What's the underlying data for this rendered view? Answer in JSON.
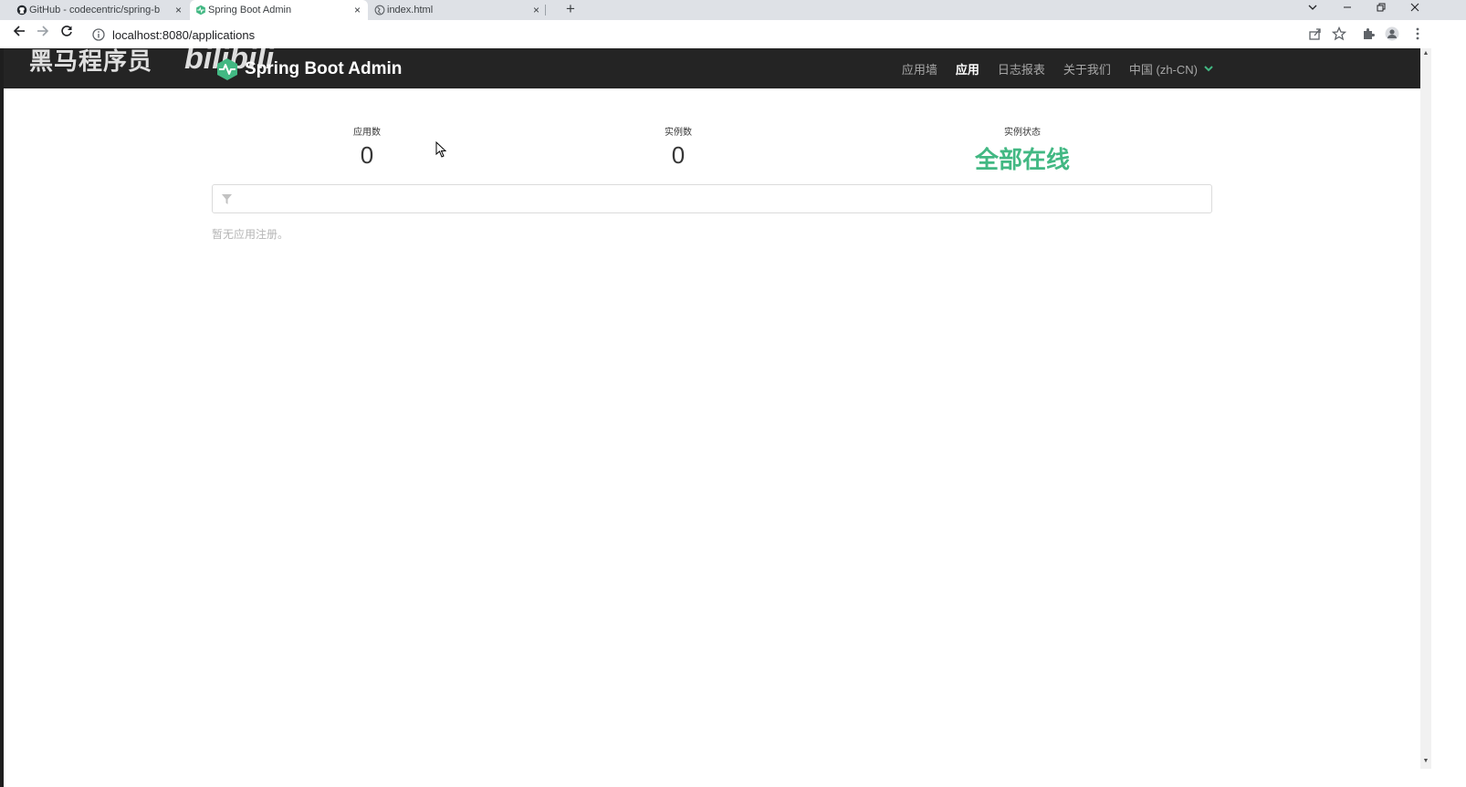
{
  "browser": {
    "tabs": [
      {
        "title": "GitHub - codecentric/spring-b",
        "icon": "github-icon",
        "active": false
      },
      {
        "title": "Spring Boot Admin",
        "icon": "spring-boot-admin-icon",
        "active": true
      },
      {
        "title": "index.html",
        "icon": "globe-icon",
        "active": false
      }
    ],
    "close_glyph": "×",
    "new_tab_glyph": "+",
    "address": "localhost:8080/applications"
  },
  "watermark": {
    "text_cn": "黑马程序员",
    "text_bili": "bilibili"
  },
  "app": {
    "brand": "Spring Boot Admin",
    "accent_color": "#42b883",
    "nav": {
      "wallboard": "应用墙",
      "applications": "应用",
      "journal": "日志报表",
      "about": "关于我们",
      "language": "中国 (zh-CN)"
    },
    "stats": {
      "applications_label": "应用数",
      "applications_value": "0",
      "instances_label": "实例数",
      "instances_value": "0",
      "status_label": "实例状态",
      "status_value": "全部在线"
    },
    "filter": {
      "placeholder": "",
      "value": ""
    },
    "empty_message": "暂无应用注册。"
  }
}
